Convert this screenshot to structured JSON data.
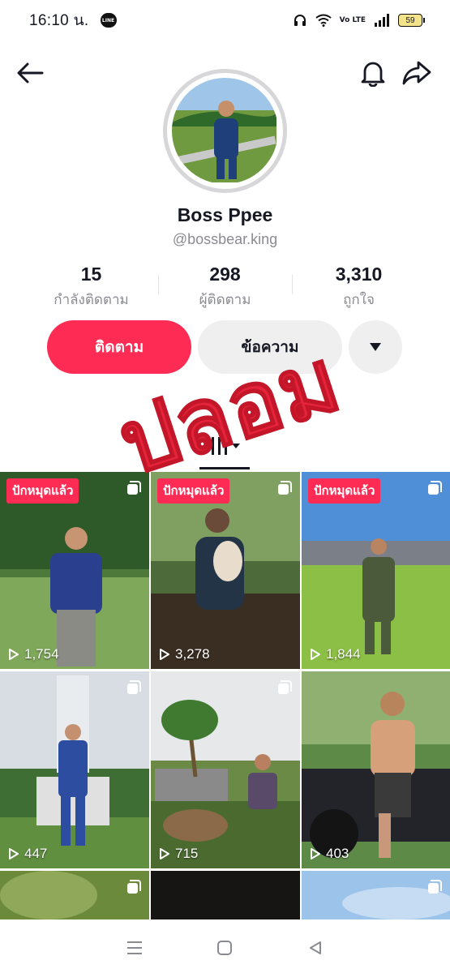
{
  "status_bar": {
    "time": "16:10 น.",
    "battery": "59",
    "line_app_label": "LINE",
    "volte": "Vo LTE"
  },
  "profile": {
    "display_name": "Boss Ppee",
    "username": "@bossbear.king"
  },
  "stats": [
    {
      "value": "15",
      "label": "กำลังติดตาม"
    },
    {
      "value": "298",
      "label": "ผู้ติดตาม"
    },
    {
      "value": "3,310",
      "label": "ถูกใจ"
    }
  ],
  "actions": {
    "follow_label": "ติดตาม",
    "message_label": "ข้อความ",
    "more_icon": "triangle-down-icon"
  },
  "overlay_stamp": {
    "text": "ปลอม",
    "color": "#e5243b"
  },
  "tabs": {
    "videos_icon": "grid-bars-icon"
  },
  "videos": [
    {
      "pinned_label": "ปักหมุดแล้ว",
      "views": "1,754",
      "multi": true
    },
    {
      "pinned_label": "ปักหมุดแล้ว",
      "views": "3,278",
      "multi": true
    },
    {
      "pinned_label": "ปักหมุดแล้ว",
      "views": "1,844",
      "multi": true
    },
    {
      "pinned_label": "",
      "views": "447",
      "multi": true
    },
    {
      "pinned_label": "",
      "views": "715",
      "multi": true
    },
    {
      "pinned_label": "",
      "views": "403",
      "multi": false
    },
    {
      "pinned_label": "",
      "views": "",
      "multi": true
    },
    {
      "pinned_label": "",
      "views": "",
      "multi": false
    },
    {
      "pinned_label": "",
      "views": "",
      "multi": true
    }
  ],
  "colors": {
    "accent": "#fe2c55",
    "secondary_button": "#efeff0",
    "muted_text": "#8a8b91"
  }
}
